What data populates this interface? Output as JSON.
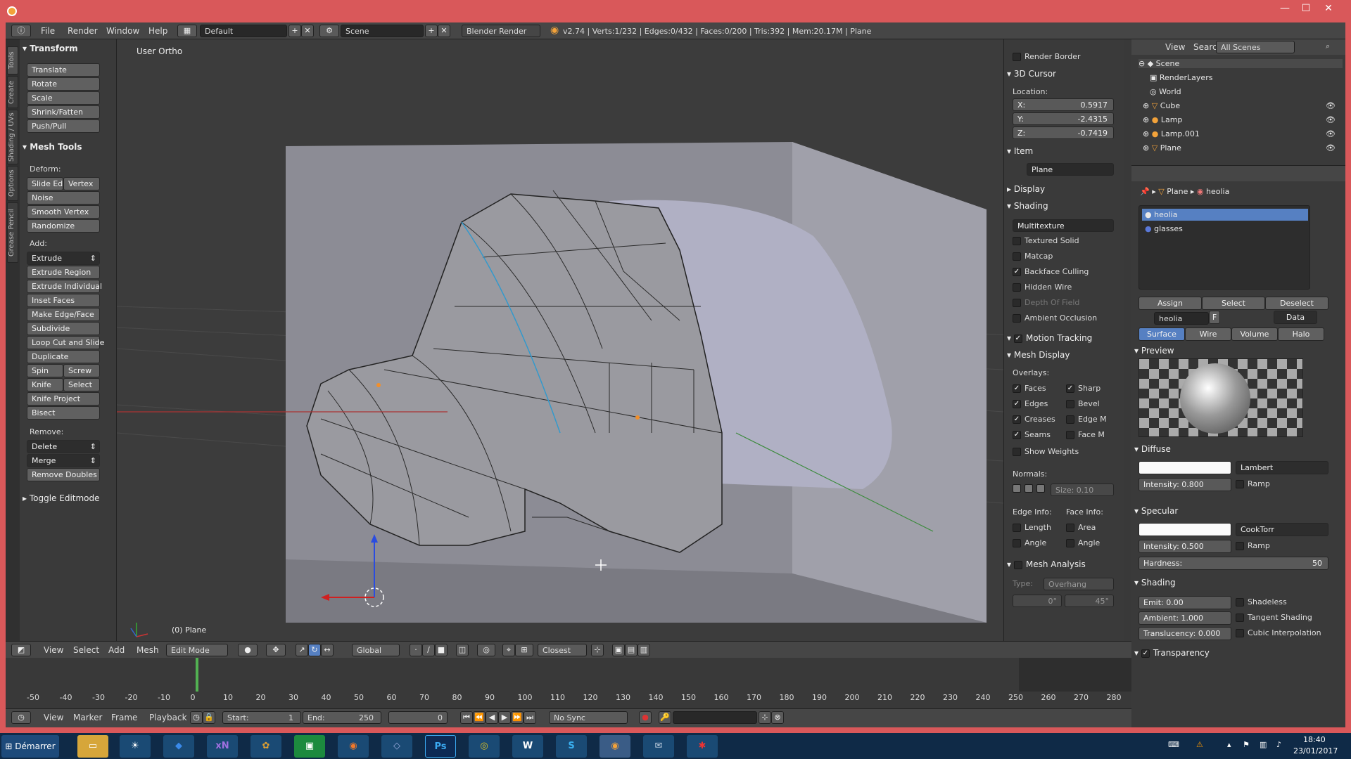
{
  "window": {
    "min": "—",
    "max": "☐",
    "close": "✕"
  },
  "header": {
    "menus": [
      "File",
      "Render",
      "Window",
      "Help"
    ],
    "layout": "Default",
    "scene": "Scene",
    "engine": "Blender Render",
    "stats": "v2.74 | Verts:1/232 | Edges:0/432 | Faces:0/200 | Tris:392 | Mem:20.17M | Plane"
  },
  "vtabs": [
    "Tools",
    "Create",
    "Shading / UVs",
    "Options",
    "Grease Pencil"
  ],
  "toolshelf": {
    "transform_title": "Transform",
    "transform": [
      "Translate",
      "Rotate",
      "Scale",
      "Shrink/Fatten",
      "Push/Pull"
    ],
    "meshtools_title": "Mesh Tools",
    "deform_label": "Deform:",
    "slide_edge": "Slide Ed",
    "vertex": "Vertex",
    "deform": [
      "Noise",
      "Smooth Vertex",
      "Randomize"
    ],
    "add_label": "Add:",
    "extrude": "Extrude",
    "add": [
      "Extrude Region",
      "Extrude Individual",
      "Inset Faces",
      "Make Edge/Face",
      "Subdivide",
      "Loop Cut and Slide",
      "Duplicate"
    ],
    "spin": "Spin",
    "screw": "Screw",
    "knife": "Knife",
    "select": "Select",
    "knife_project": "Knife Project",
    "bisect": "Bisect",
    "remove_label": "Remove:",
    "delete": "Delete",
    "merge": "Merge",
    "remove_doubles": "Remove Doubles",
    "toggle_editmode": "Toggle Editmode"
  },
  "viewport": {
    "label": "User Ortho",
    "object": "(0) Plane"
  },
  "nshelf": {
    "render_border": "Render Border",
    "cursor_title": "3D Cursor",
    "location": "Location:",
    "x_label": "X:",
    "x": "0.5917",
    "y_label": "Y:",
    "y": "-2.4315",
    "z_label": "Z:",
    "z": "-0.7419",
    "item_title": "Item",
    "item_name": "Plane",
    "display_title": "Display",
    "shading_title": "Shading",
    "shading_mode": "Multitexture",
    "textured_solid": "Textured Solid",
    "matcap": "Matcap",
    "backface": "Backface Culling",
    "hidden_wire": "Hidden Wire",
    "dof": "Depth Of Field",
    "ao": "Ambient Occlusion",
    "motion_tracking": "Motion Tracking",
    "mesh_display": "Mesh Display",
    "overlays": "Overlays:",
    "faces": "Faces",
    "sharp": "Sharp",
    "edges": "Edges",
    "bevel": "Bevel",
    "creases": "Creases",
    "edge_m": "Edge M",
    "seams": "Seams",
    "face_m": "Face M",
    "show_weights": "Show Weights",
    "normals": "Normals:",
    "size": "Size: 0.10",
    "edge_info": "Edge Info:",
    "face_info": "Face Info:",
    "length": "Length",
    "area": "Area",
    "angle": "Angle",
    "angle2": "Angle",
    "mesh_analysis": "Mesh Analysis",
    "type_label": "Type:",
    "type": "Overhang",
    "deg0": "0°",
    "deg45": "45°"
  },
  "outliner": {
    "view": "View",
    "search": "Search",
    "scenes": "All Scenes",
    "items": [
      "Scene",
      "RenderLayers",
      "World",
      "Cube",
      "Lamp",
      "Lamp.001",
      "Plane"
    ]
  },
  "properties": {
    "breadcrumb_obj": "Plane",
    "breadcrumb_mat": "heolia",
    "slots": [
      "heolia",
      "glasses"
    ],
    "assign": "Assign",
    "select": "Select",
    "deselect": "Deselect",
    "material_name": "heolia",
    "f": "F",
    "data": "Data",
    "tabs": [
      "Surface",
      "Wire",
      "Volume",
      "Halo"
    ],
    "preview": "Preview",
    "diffuse": "Diffuse",
    "lambert": "Lambert",
    "d_intensity": "Intensity:",
    "d_intensity_v": "0.800",
    "ramp": "Ramp",
    "specular": "Specular",
    "cooktorr": "CookTorr",
    "s_intensity": "Intensity:",
    "s_intensity_v": "0.500",
    "ramp2": "Ramp",
    "hardness": "Hardness:",
    "hardness_v": "50",
    "shading": "Shading",
    "emit": "Emit:",
    "emit_v": "0.00",
    "shadeless": "Shadeless",
    "ambient": "Ambient:",
    "ambient_v": "1.000",
    "tangent": "Tangent Shading",
    "translucency": "Translucency:",
    "translucency_v": "0.000",
    "cubic": "Cubic Interpolation",
    "transparency": "Transparency"
  },
  "viewfooter": {
    "menus": [
      "View",
      "Select",
      "Add",
      "Mesh"
    ],
    "mode": "Edit Mode",
    "orientation": "Global",
    "snap": "Closest"
  },
  "timeline": {
    "ticks": [
      "-50",
      "-40",
      "-30",
      "-20",
      "-10",
      "0",
      "10",
      "20",
      "30",
      "40",
      "50",
      "60",
      "70",
      "80",
      "90",
      "100",
      "110",
      "120",
      "130",
      "140",
      "150",
      "160",
      "170",
      "180",
      "190",
      "200",
      "210",
      "220",
      "230",
      "240",
      "250",
      "260",
      "270",
      "280"
    ],
    "menus": [
      "View",
      "Marker",
      "Frame",
      "Playback"
    ],
    "start": "Start:",
    "start_v": "1",
    "end": "End:",
    "end_v": "250",
    "current": "0",
    "sync": "No Sync"
  },
  "taskbar": {
    "start": "Démarrer",
    "time": "18:40",
    "date": "23/01/2017"
  }
}
